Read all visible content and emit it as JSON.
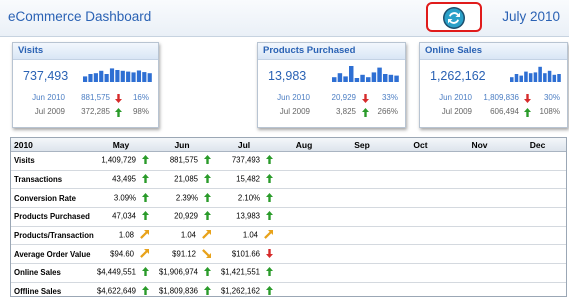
{
  "header": {
    "app_title": "eCommerce Dashboard",
    "period": "July 2010",
    "refresh_icon": "refresh-icon"
  },
  "colors": {
    "accent": "#2a62b4",
    "bar": "#2e6fd3",
    "up": "#2a9b2a",
    "down": "#d62b2b",
    "flat": "#e8a21a",
    "highlight": "#e01b1b"
  },
  "kpis": [
    {
      "title": "Visits",
      "value": "737,493",
      "spark": [
        0.35,
        0.5,
        0.55,
        0.7,
        0.5,
        0.85,
        0.75,
        0.7,
        0.65,
        0.6,
        0.72,
        0.62,
        0.55
      ],
      "rows": [
        {
          "label": "Jun 2010",
          "value": "881,575",
          "trend": "down",
          "pct": "16%"
        },
        {
          "label": "Jul 2009",
          "value": "372,285",
          "trend": "up",
          "pct": "98%"
        }
      ]
    },
    {
      "title": "Products Purchased",
      "value": "13,983",
      "spark": [
        0.3,
        0.55,
        0.35,
        1.0,
        0.25,
        0.45,
        0.3,
        0.6,
        0.9,
        0.5,
        0.45,
        0.4
      ],
      "rows": [
        {
          "label": "Jun 2010",
          "value": "20,929",
          "trend": "down",
          "pct": "33%"
        },
        {
          "label": "Jul 2009",
          "value": "3,825",
          "trend": "up",
          "pct": "266%"
        }
      ]
    },
    {
      "title": "Online Sales",
      "value": "1,262,162",
      "spark": [
        0.3,
        0.5,
        0.4,
        0.65,
        0.55,
        0.6,
        0.95,
        0.55,
        0.7,
        0.45,
        0.5
      ],
      "rows": [
        {
          "label": "Jun 2010",
          "value": "1,809,836",
          "trend": "down",
          "pct": "30%"
        },
        {
          "label": "Jul 2009",
          "value": "606,494",
          "trend": "up",
          "pct": "108%"
        }
      ]
    }
  ],
  "table": {
    "columns": [
      "2010",
      "May",
      "Jun",
      "Jul",
      "Aug",
      "Sep",
      "Oct",
      "Nov",
      "Dec"
    ],
    "rows": [
      {
        "metric": "Visits",
        "cells": [
          [
            "1,409,729",
            "up"
          ],
          [
            "881,575",
            "up"
          ],
          [
            "737,493",
            "up"
          ]
        ]
      },
      {
        "metric": "Transactions",
        "cells": [
          [
            "43,495",
            "up"
          ],
          [
            "21,085",
            "up"
          ],
          [
            "15,482",
            "up"
          ]
        ]
      },
      {
        "metric": "Conversion Rate",
        "cells": [
          [
            "3.09%",
            "up"
          ],
          [
            "2.39%",
            "up"
          ],
          [
            "2.10%",
            "up"
          ]
        ]
      },
      {
        "metric": "Products Purchased",
        "cells": [
          [
            "47,034",
            "up"
          ],
          [
            "20,929",
            "up"
          ],
          [
            "13,983",
            "up"
          ]
        ]
      },
      {
        "metric": "Products/Transaction",
        "cells": [
          [
            "1.08",
            "flat-up"
          ],
          [
            "1.04",
            "flat-up"
          ],
          [
            "1.04",
            "flat-up"
          ]
        ]
      },
      {
        "metric": "Average Order Value",
        "cells": [
          [
            "$94.60",
            "flat-up"
          ],
          [
            "$91.12",
            "flat-down"
          ],
          [
            "$101.66",
            "down"
          ]
        ]
      },
      {
        "metric": "Online Sales",
        "cells": [
          [
            "$4,449,551",
            "up"
          ],
          [
            "$1,906,974",
            "up"
          ],
          [
            "$1,421,551",
            "up"
          ]
        ]
      },
      {
        "metric": "Offline Sales",
        "cells": [
          [
            "$4,622,649",
            "up"
          ],
          [
            "$1,809,836",
            "up"
          ],
          [
            "$1,262,162",
            "up"
          ]
        ]
      }
    ]
  }
}
